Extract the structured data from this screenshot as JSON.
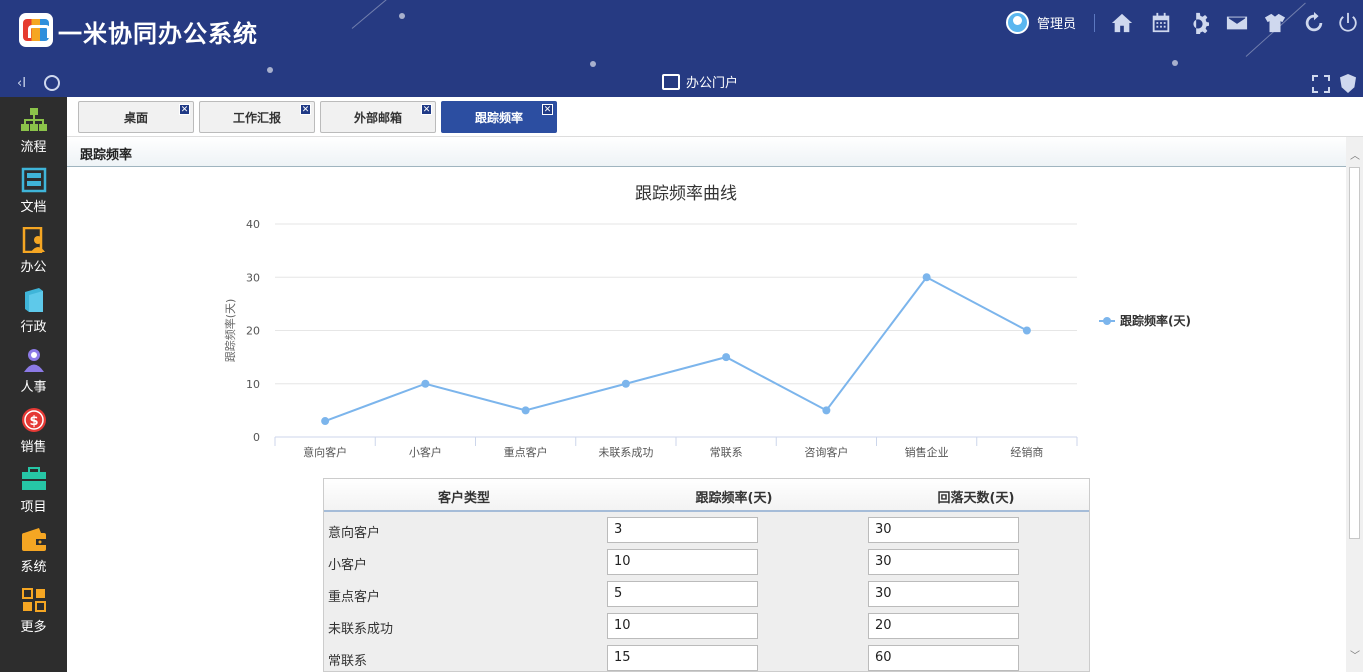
{
  "app": {
    "title": "一米协同办公系统",
    "user_name": "管理员",
    "portal_label": "办公门户",
    "collapse_glyph": "‹I"
  },
  "header_icons": [
    "home-icon",
    "calendar-icon",
    "gear-icon",
    "mail-icon",
    "shirt-icon",
    "refresh-icon",
    "power-icon"
  ],
  "sidebar": {
    "items": [
      {
        "label": "流程",
        "icon": "flow-icon",
        "color": "#8bc34a"
      },
      {
        "label": "文档",
        "icon": "document-icon",
        "color": "#3fb5d9"
      },
      {
        "label": "办公",
        "icon": "office-icon",
        "color": "#f5a623"
      },
      {
        "label": "行政",
        "icon": "admin-icon",
        "color": "#3fb5d9"
      },
      {
        "label": "人事",
        "icon": "person-icon",
        "color": "#8c7ae6"
      },
      {
        "label": "销售",
        "icon": "dollar-icon",
        "color": "#e53935"
      },
      {
        "label": "项目",
        "icon": "project-icon",
        "color": "#26c6a6"
      },
      {
        "label": "系统",
        "icon": "wallet-icon",
        "color": "#f5a623"
      },
      {
        "label": "更多",
        "icon": "grid-icon",
        "color": "#f5a623"
      }
    ]
  },
  "tabs": [
    {
      "label": "桌面",
      "active": false
    },
    {
      "label": "工作汇报",
      "active": false
    },
    {
      "label": "外部邮箱",
      "active": false
    },
    {
      "label": "跟踪频率",
      "active": true
    }
  ],
  "content": {
    "title": "跟踪频率"
  },
  "chart_data": {
    "type": "line",
    "title": "跟踪频率曲线",
    "xlabel": "",
    "ylabel": "跟踪频率(天)",
    "ylim": [
      0,
      40
    ],
    "yticks": [
      0,
      10,
      20,
      30,
      40
    ],
    "categories": [
      "意向客户",
      "小客户",
      "重点客户",
      "未联系成功",
      "常联系",
      "咨询客户",
      "销售企业",
      "经销商"
    ],
    "series": [
      {
        "name": "跟踪频率(天)",
        "values": [
          3,
          10,
          5,
          10,
          15,
          5,
          30,
          20
        ],
        "color": "#7cb5ec"
      }
    ],
    "legend_position": "right",
    "grid": true
  },
  "table": {
    "headers": [
      "客户类型",
      "跟踪频率(天)",
      "回落天数(天)"
    ],
    "rows": [
      {
        "type": "意向客户",
        "freq": "3",
        "fallback": "30"
      },
      {
        "type": "小客户",
        "freq": "10",
        "fallback": "30"
      },
      {
        "type": "重点客户",
        "freq": "5",
        "fallback": "30"
      },
      {
        "type": "未联系成功",
        "freq": "10",
        "fallback": "20"
      },
      {
        "type": "常联系",
        "freq": "15",
        "fallback": "60"
      }
    ]
  }
}
